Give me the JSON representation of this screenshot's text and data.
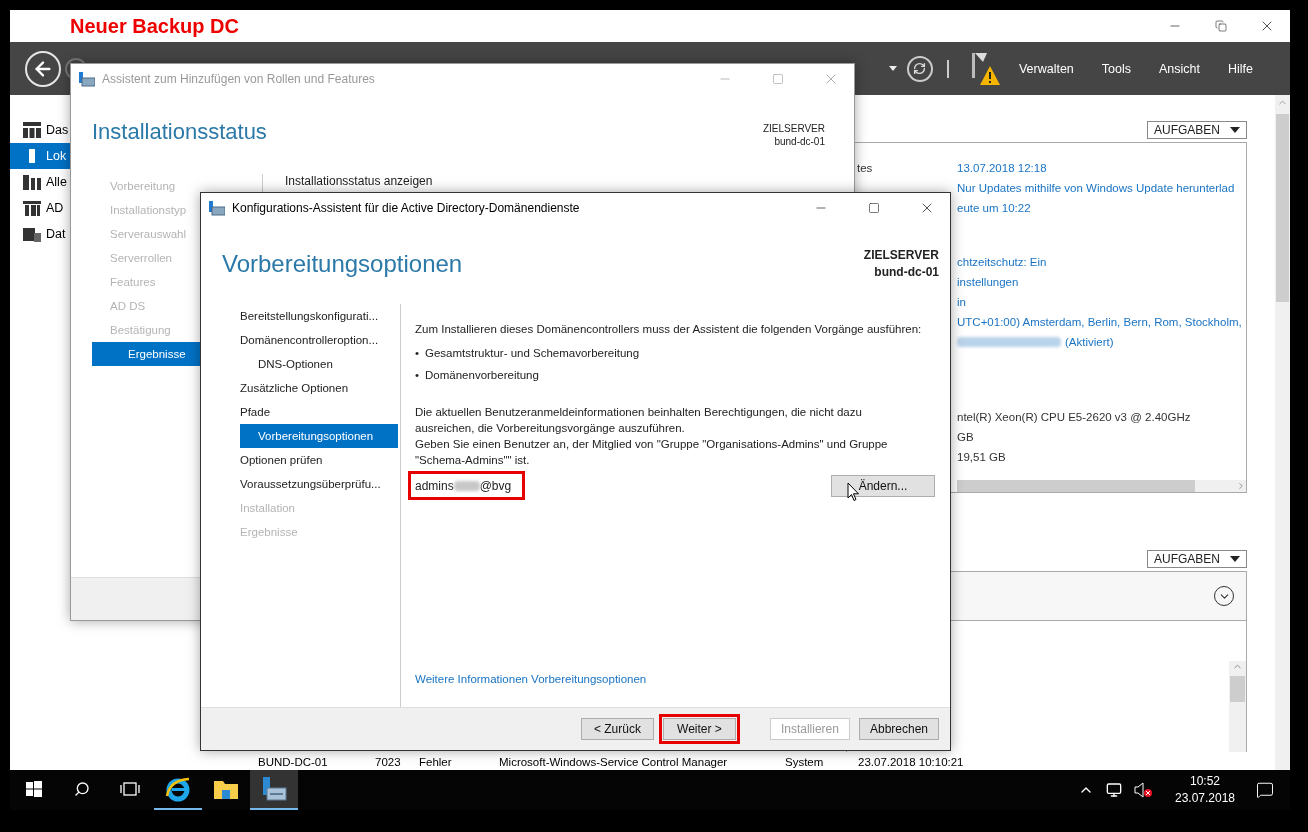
{
  "annotation": {
    "text": "Neuer Backup DC"
  },
  "server_manager": {
    "menu": [
      {
        "label": "Verwalten"
      },
      {
        "label": "Tools"
      },
      {
        "label": "Ansicht"
      },
      {
        "label": "Hilfe"
      }
    ],
    "sidebar": [
      {
        "label": "Das",
        "selected": false
      },
      {
        "label": "Lok",
        "selected": true
      },
      {
        "label": "Alle",
        "selected": false
      },
      {
        "label": "AD",
        "selected": false
      },
      {
        "label": "Dat",
        "selected": false
      }
    ],
    "properties": {
      "tasks_button": "AUFGABEN",
      "groups": [
        [
          {
            "kind": "link",
            "label": "tes",
            "value": "13.07.2018 12:18"
          },
          {
            "kind": "link",
            "value": "Nur Updates mithilfe von Windows Update herunterlad"
          },
          {
            "kind": "link",
            "value": "eute um 10:22"
          }
        ],
        [
          {
            "kind": "link",
            "value": "chtzeitschutz: Ein"
          },
          {
            "kind": "link",
            "value": "instellungen"
          },
          {
            "kind": "link",
            "value": "in"
          },
          {
            "kind": "link",
            "value": "UTC+01:00) Amsterdam, Berlin, Bern, Rom, Stockholm,"
          },
          {
            "kind": "masked-link",
            "value": "(Aktiviert)"
          }
        ],
        [
          {
            "kind": "text",
            "value": "ntel(R) Xeon(R) CPU E5-2620 v3 @ 2.40GHz"
          },
          {
            "kind": "text",
            "value": "GB"
          },
          {
            "kind": "text",
            "value": "19,51 GB"
          }
        ]
      ]
    },
    "events": {
      "tasks_button": "AUFGABEN",
      "rows": [
        [
          "BUND-DC-01",
          "7023",
          "Fehler",
          "Microsoft-Windows-Service Control Manager",
          "System",
          "23.07.2018 10:10:21"
        ]
      ]
    }
  },
  "roles_wizard": {
    "title": "Assistent zum Hinzufügen von Rollen und Features",
    "active": false,
    "heading": "Installationsstatus",
    "target_label": "ZIELSERVER",
    "target_server": "bund-dc-01",
    "section_title": "Installationsstatus anzeigen",
    "steps": [
      {
        "label": "Vorbereitung",
        "selected": false,
        "disabled": true
      },
      {
        "label": "Installationstyp",
        "selected": false,
        "disabled": true
      },
      {
        "label": "Serverauswahl",
        "selected": false,
        "disabled": true
      },
      {
        "label": "Serverrollen",
        "selected": false,
        "disabled": true
      },
      {
        "label": "Features",
        "selected": false,
        "disabled": true
      },
      {
        "label": "AD DS",
        "selected": false,
        "disabled": true
      },
      {
        "label": "Bestätigung",
        "selected": false,
        "disabled": true
      },
      {
        "label": "Ergebnisse",
        "selected": true,
        "disabled": false
      }
    ]
  },
  "adds_wizard": {
    "title": "Konfigurations-Assistent für die Active Directory-Domänendienste",
    "active": true,
    "heading": "Vorbereitungsoptionen",
    "target_label": "ZIELSERVER",
    "target_server": "bund-dc-01",
    "steps": [
      {
        "label": "Bereitstellungskonfigurati...",
        "selected": false,
        "disabled": false
      },
      {
        "label": "Domänencontrolleroption...",
        "selected": false,
        "disabled": false,
        "children": [
          {
            "label": "DNS-Optionen",
            "selected": false,
            "disabled": false
          }
        ]
      },
      {
        "label": "Zusätzliche Optionen",
        "selected": false,
        "disabled": false
      },
      {
        "label": "Pfade",
        "selected": false,
        "disabled": false
      },
      {
        "label": "Vorbereitungsoptionen",
        "selected": true,
        "disabled": false
      },
      {
        "label": "Optionen prüfen",
        "selected": false,
        "disabled": false
      },
      {
        "label": "Voraussetzungsüberprüfu...",
        "selected": false,
        "disabled": false
      },
      {
        "label": "Installation",
        "selected": false,
        "disabled": true
      },
      {
        "label": "Ergebnisse",
        "selected": false,
        "disabled": true
      }
    ],
    "intro": "Zum Installieren dieses Domänencontrollers muss der Assistent die folgenden Vorgänge ausführen:",
    "tasks": [
      {
        "marker": "•",
        "text": "Gesamtstruktur- und Schemavorbereitung"
      },
      {
        "marker": "•",
        "text": "Domänenvorbereitung"
      }
    ],
    "notes": [
      "Die aktuellen Benutzeranmeldeinformationen beinhalten Berechtigungen, die nicht dazu ausreichen, die Vorbereitungsvorgänge auszuführen.",
      "Geben Sie einen Benutzer an, der Mitglied von \"Gruppe \"Organisations-Admins\" und Gruppe \"Schema-Admins\"\" ist."
    ],
    "account": {
      "start": "admins",
      "end": "@bvg",
      "highlighted": true
    },
    "change_button": "Ändern...",
    "more_info_link": "Weitere Informationen Vorbereitungsoptionen",
    "buttons": [
      {
        "label": "< Zurück",
        "disabled": false,
        "highlighted": false
      },
      {
        "label": "Weiter >",
        "disabled": false,
        "highlighted": true
      },
      {
        "label": "Installieren",
        "disabled": true,
        "highlighted": false
      },
      {
        "label": "Abbrechen",
        "disabled": false,
        "highlighted": false
      }
    ]
  },
  "taskbar": {
    "apps": [
      {
        "kind": "browser",
        "running": true,
        "selected": false
      },
      {
        "kind": "files",
        "running": false,
        "selected": false
      },
      {
        "kind": "server-manager",
        "running": true,
        "selected": true
      }
    ],
    "time": "10:52",
    "date": "23.07.2018"
  }
}
